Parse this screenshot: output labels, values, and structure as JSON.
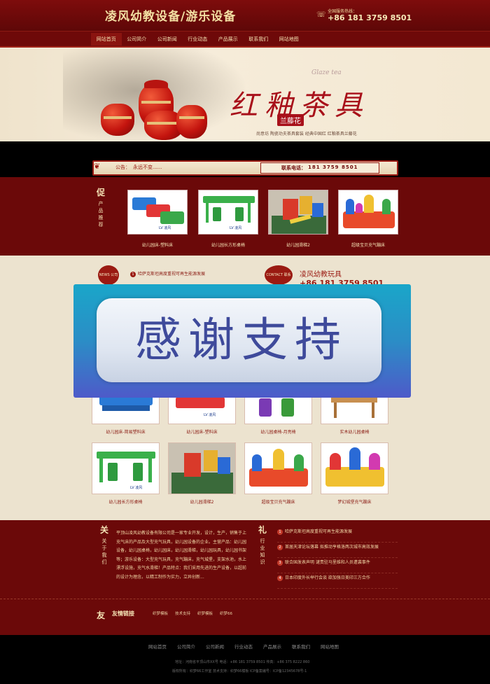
{
  "header": {
    "logo": "凌风幼教设备/游乐设备",
    "phone_label": "全国服务热线：",
    "phone": "+86 181 3759 8501"
  },
  "nav": [
    "网站首页",
    "公司简介",
    "公司新闻",
    "行业动态",
    "产品展示",
    "联系我们",
    "网站地图"
  ],
  "banner": {
    "title": "红釉茶具",
    "script": "Glaze tea",
    "tag": "兰藤花",
    "desc": "尚意坊  陶瓷功夫茶具套装  经典中国红  红釉茶具兰藤花"
  },
  "notice": {
    "label": "公告：",
    "text": "永远不变......",
    "contact_label": "联系电话：",
    "contact_num": "181 3759 8501"
  },
  "recommend": {
    "side_big": "促",
    "side_text": "产品推荐",
    "items": [
      "幼儿园床-塑料床",
      "幼儿园长方形桌椅",
      "幼儿园滑梯2",
      "超级宝贝充气蹦床"
    ]
  },
  "news": {
    "badge": "NEWS 公司新闻",
    "first": "哈萨克斯坦高度重视可再生能源发展",
    "contact_badge": "CONTACT 联系方式",
    "contact_title": "凌风幼教玩具",
    "contact_phone": "+86 181 3759 8501"
  },
  "overlay": {
    "text": "感谢支持"
  },
  "products": [
    "幼儿园床-简易塑料床",
    "幼儿园床-塑料床",
    "幼儿园桌椅-月亮椅",
    "实木幼儿园桌椅",
    "幼儿园长方形桌椅",
    "幼儿园滑梯2",
    "超级宝贝充气蹦床",
    "梦幻城堡充气蹦床"
  ],
  "about": {
    "side_big": "关",
    "side_text": "关于我们",
    "text": "平顶山凌风幼教设备有限公司是一家专业开发，设计，生产，销售于上充气床的产品及大型充气玩具，幼儿园设备的企业。主营产品：幼儿园设备，幼儿园桌椅，幼儿园床，幼儿园滑梯，幼儿园玩具，幼儿园书架等；游乐设备：大型充气玩具，充气蹦床，充气城堡，支架水池，水上漂浮设施，充气水滑梯！产品特点：我们采用先进的生产设备，以超前的设计为理念，以精工制作为实力，立异创新..."
  },
  "industry": {
    "side_big": "礼",
    "side_text": "行业知识",
    "items": [
      "哈萨克斯坦高度重视可再生能源发展",
      "首届天津论坛落幕 拟推动亨格洛两次城市高效发展",
      "联合国发表声明 谴责驻马里维和人员遭袭事件",
      "日本印度外长举行会谈 欲加强日美印三方合作"
    ]
  },
  "links": {
    "icon": "友",
    "title": "友情链接",
    "items": [
      "织梦模板",
      "技术支持",
      "织梦模板",
      "织梦66"
    ]
  },
  "footer": {
    "nav": [
      "网站首页",
      "公司简介",
      "公司新闻",
      "行业动态",
      "产品展示",
      "联系我们",
      "网站地图"
    ],
    "line1": "地址：河南省平顶山市XX号    电话：+86 181 3759 8501    传真：+86 375 8222 860",
    "line2": "版权所有：织梦66工作室    技术支持：织梦66模板    ICP备案编号：ICP备12345678号-1"
  },
  "colors": {
    "brand_red": "#6b0909",
    "accent": "#9a1a12",
    "cream": "#ece3cf",
    "gold_text": "#f5e3b5"
  }
}
